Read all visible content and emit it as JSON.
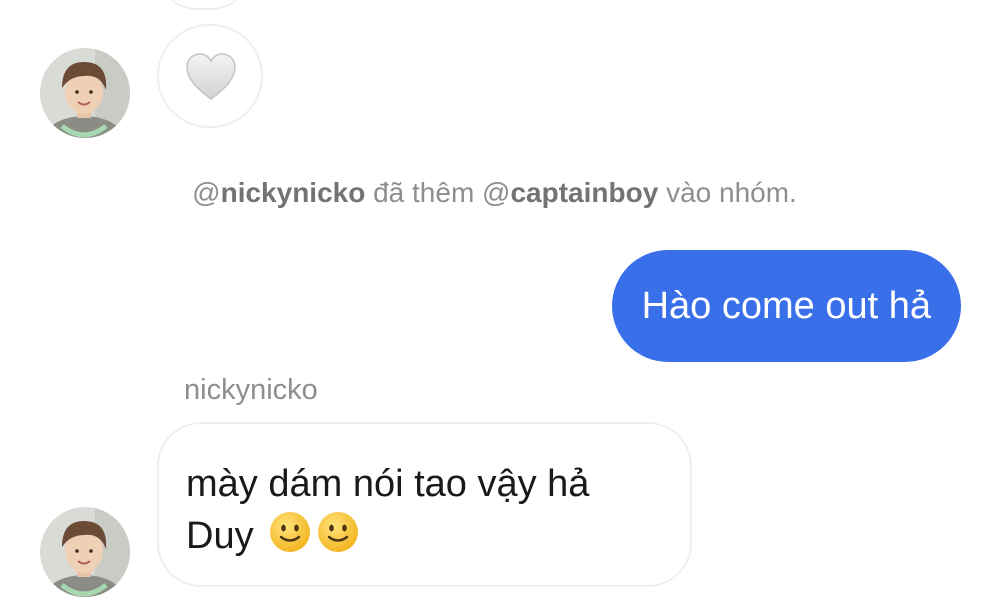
{
  "thread": {
    "heart_message": {
      "icon": "white-heart-icon"
    },
    "system_note": {
      "prefix": "@",
      "actor": "nickynicko",
      "middle": " đã thêm @",
      "target": "captainboy",
      "suffix": " vào nhóm."
    },
    "sent_message": {
      "text": "Hào come out hả",
      "color": "#3a6fea"
    },
    "received_message": {
      "sender": "nickynicko",
      "line1": "mày dám nói tao vậy hả",
      "line2": "Duy",
      "emojis": [
        "slightly-smiling-face-icon",
        "slightly-smiling-face-icon"
      ]
    }
  }
}
